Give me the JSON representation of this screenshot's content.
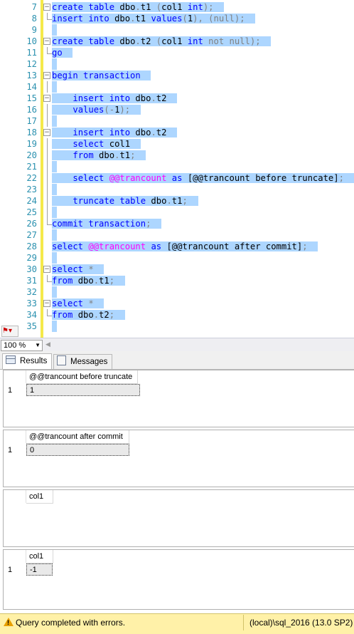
{
  "editor": {
    "lines": [
      {
        "num": "7",
        "fold": "minus",
        "tokens": [
          [
            "k",
            "create table "
          ],
          [
            "t",
            "dbo"
          ],
          [
            "g",
            "."
          ],
          [
            "t",
            "t1 "
          ],
          [
            "g",
            "("
          ],
          [
            "t",
            "col1 "
          ],
          [
            "k",
            "int"
          ],
          [
            "g",
            ");"
          ]
        ]
      },
      {
        "num": "8",
        "fold": "end",
        "tokens": [
          [
            "k",
            "insert into "
          ],
          [
            "t",
            "dbo"
          ],
          [
            "g",
            "."
          ],
          [
            "t",
            "t1 "
          ],
          [
            "k",
            "values"
          ],
          [
            "g",
            "("
          ],
          [
            "t",
            "1"
          ],
          [
            "g",
            "), ("
          ],
          [
            "g",
            "null"
          ],
          [
            "g",
            ");"
          ]
        ]
      },
      {
        "num": "9",
        "fold": "",
        "tokens": []
      },
      {
        "num": "10",
        "fold": "minus",
        "tokens": [
          [
            "k",
            "create table "
          ],
          [
            "t",
            "dbo"
          ],
          [
            "g",
            "."
          ],
          [
            "t",
            "t2 "
          ],
          [
            "g",
            "("
          ],
          [
            "t",
            "col1 "
          ],
          [
            "k",
            "int "
          ],
          [
            "g",
            "not null"
          ],
          [
            "g",
            ");"
          ]
        ]
      },
      {
        "num": "11",
        "fold": "end",
        "tokens": [
          [
            "k",
            "go"
          ]
        ]
      },
      {
        "num": "12",
        "fold": "",
        "tokens": []
      },
      {
        "num": "13",
        "fold": "minus",
        "tokens": [
          [
            "k",
            "begin transaction"
          ]
        ]
      },
      {
        "num": "14",
        "fold": "bar",
        "tokens": []
      },
      {
        "num": "15",
        "fold": "minus",
        "tokens": [
          [
            "t",
            "    "
          ],
          [
            "k",
            "insert into "
          ],
          [
            "t",
            "dbo"
          ],
          [
            "g",
            "."
          ],
          [
            "t",
            "t2"
          ]
        ]
      },
      {
        "num": "16",
        "fold": "bar",
        "tokens": [
          [
            "t",
            "    "
          ],
          [
            "k",
            "values"
          ],
          [
            "g",
            "("
          ],
          [
            "g",
            "-"
          ],
          [
            "t",
            "1"
          ],
          [
            "g",
            ");"
          ]
        ]
      },
      {
        "num": "17",
        "fold": "bar",
        "tokens": []
      },
      {
        "num": "18",
        "fold": "minus",
        "tokens": [
          [
            "t",
            "    "
          ],
          [
            "k",
            "insert into "
          ],
          [
            "t",
            "dbo"
          ],
          [
            "g",
            "."
          ],
          [
            "t",
            "t2"
          ]
        ]
      },
      {
        "num": "19",
        "fold": "bar",
        "tokens": [
          [
            "t",
            "    "
          ],
          [
            "k",
            "select "
          ],
          [
            "t",
            "col1"
          ]
        ]
      },
      {
        "num": "20",
        "fold": "bar",
        "tokens": [
          [
            "t",
            "    "
          ],
          [
            "k",
            "from "
          ],
          [
            "t",
            "dbo"
          ],
          [
            "g",
            "."
          ],
          [
            "t",
            "t1"
          ],
          [
            "g",
            ";"
          ]
        ]
      },
      {
        "num": "21",
        "fold": "bar",
        "tokens": []
      },
      {
        "num": "22",
        "fold": "bar",
        "tokens": [
          [
            "t",
            "    "
          ],
          [
            "k",
            "select "
          ],
          [
            "m",
            "@@trancount "
          ],
          [
            "k",
            "as "
          ],
          [
            "t",
            "[@@trancount before truncate]"
          ],
          [
            "g",
            ";"
          ]
        ]
      },
      {
        "num": "23",
        "fold": "bar",
        "tokens": []
      },
      {
        "num": "24",
        "fold": "bar",
        "tokens": [
          [
            "t",
            "    "
          ],
          [
            "k",
            "truncate table "
          ],
          [
            "t",
            "dbo"
          ],
          [
            "g",
            "."
          ],
          [
            "t",
            "t1"
          ],
          [
            "g",
            ";"
          ]
        ]
      },
      {
        "num": "25",
        "fold": "bar",
        "tokens": []
      },
      {
        "num": "26",
        "fold": "end",
        "tokens": [
          [
            "k",
            "commit transaction"
          ],
          [
            "g",
            ";"
          ]
        ]
      },
      {
        "num": "27",
        "fold": "",
        "tokens": []
      },
      {
        "num": "28",
        "fold": "",
        "tokens": [
          [
            "k",
            "select "
          ],
          [
            "m",
            "@@trancount "
          ],
          [
            "k",
            "as "
          ],
          [
            "t",
            "[@@trancount after commit]"
          ],
          [
            "g",
            ";"
          ]
        ]
      },
      {
        "num": "29",
        "fold": "",
        "tokens": []
      },
      {
        "num": "30",
        "fold": "minus",
        "tokens": [
          [
            "k",
            "select "
          ],
          [
            "g",
            "*"
          ]
        ]
      },
      {
        "num": "31",
        "fold": "end",
        "tokens": [
          [
            "k",
            "from "
          ],
          [
            "t",
            "dbo"
          ],
          [
            "g",
            "."
          ],
          [
            "t",
            "t1"
          ],
          [
            "g",
            ";"
          ]
        ]
      },
      {
        "num": "32",
        "fold": "",
        "tokens": []
      },
      {
        "num": "33",
        "fold": "minus",
        "tokens": [
          [
            "k",
            "select "
          ],
          [
            "g",
            "*"
          ]
        ]
      },
      {
        "num": "34",
        "fold": "end",
        "tokens": [
          [
            "k",
            "from "
          ],
          [
            "t",
            "dbo"
          ],
          [
            "g",
            "."
          ],
          [
            "t",
            "t2"
          ],
          [
            "g",
            ";"
          ]
        ]
      },
      {
        "num": "35",
        "fold": "",
        "tokens": []
      }
    ]
  },
  "zoom": {
    "value": "100 %"
  },
  "tabs": {
    "results": "Results",
    "messages": "Messages"
  },
  "grids": [
    {
      "header": "@@trancount before truncate",
      "rows": [
        {
          "num": "1",
          "value": "1"
        }
      ]
    },
    {
      "header": "@@trancount after commit",
      "rows": [
        {
          "num": "1",
          "value": "0"
        }
      ]
    },
    {
      "header": "col1",
      "rows": []
    },
    {
      "header": "col1",
      "rows": [
        {
          "num": "1",
          "value": "-1"
        }
      ]
    }
  ],
  "status": {
    "message": "Query completed with errors.",
    "server": "(local)\\sql_2016 (13.0 SP2)"
  },
  "colors": {
    "keyword": "#0000ff",
    "operator": "#808080",
    "system_function": "#ff00ff",
    "line_number": "#2b91af",
    "selection": "#add6ff",
    "status_bar": "#fff1a8"
  }
}
